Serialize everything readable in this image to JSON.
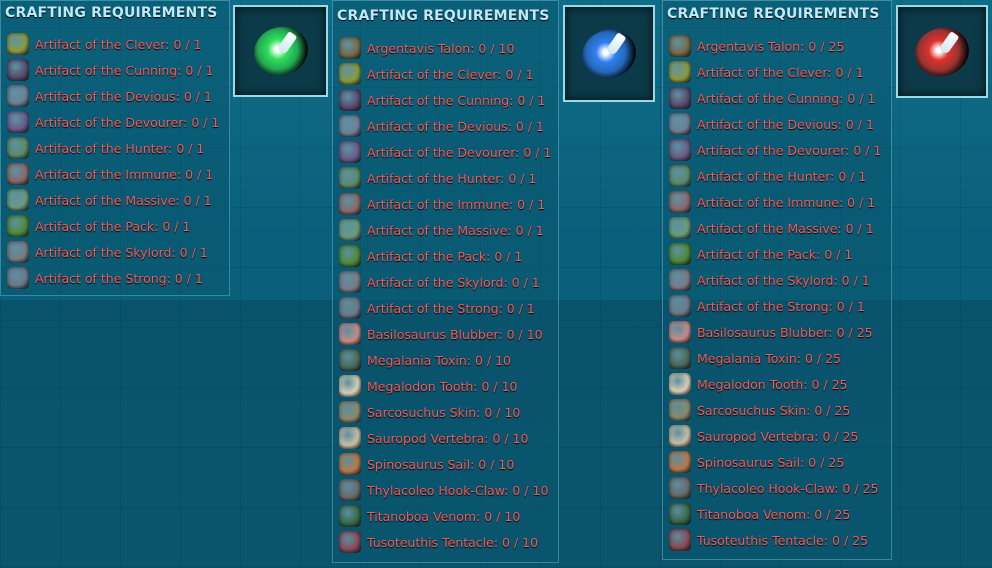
{
  "panels": [
    {
      "title": "CRAFTING REQUIREMENTS",
      "item_icon": "green-tribute-orb-icon",
      "orb_color": "#2fe05a",
      "items": [
        {
          "label": "Artifact of the Clever: 0 / 1",
          "icon": "artifact-clever-icon",
          "color": "#8c9a3e"
        },
        {
          "label": "Artifact of the Cunning: 0 / 1",
          "icon": "artifact-cunning-icon",
          "color": "#5a4a6e"
        },
        {
          "label": "Artifact of the Devious: 0 / 1",
          "icon": "artifact-devious-icon",
          "color": "#6f7f95"
        },
        {
          "label": "Artifact of the Devourer: 0 / 1",
          "icon": "artifact-devourer-icon",
          "color": "#6a5a8a"
        },
        {
          "label": "Artifact of the Hunter: 0 / 1",
          "icon": "artifact-hunter-icon",
          "color": "#5a8a6a"
        },
        {
          "label": "Artifact of the Immune: 0 / 1",
          "icon": "artifact-immune-icon",
          "color": "#8a6a6a"
        },
        {
          "label": "Artifact of the Massive: 0 / 1",
          "icon": "artifact-massive-icon",
          "color": "#6a9a7a"
        },
        {
          "label": "Artifact of the Pack: 0 / 1",
          "icon": "artifact-pack-icon",
          "color": "#4f8a3a"
        },
        {
          "label": "Artifact of the Skylord: 0 / 1",
          "icon": "artifact-skylord-icon",
          "color": "#7a7a86"
        },
        {
          "label": "Artifact of the Strong: 0 / 1",
          "icon": "artifact-strong-icon",
          "color": "#6a7a8a"
        }
      ]
    },
    {
      "title": "CRAFTING REQUIREMENTS",
      "item_icon": "blue-tribute-orb-icon",
      "orb_color": "#2f7ff0",
      "items": [
        {
          "label": "Argentavis Talon: 0 / 10",
          "icon": "argentavis-talon-icon",
          "color": "#7a6a4a"
        },
        {
          "label": "Artifact of the Clever: 0 / 1",
          "icon": "artifact-clever-icon",
          "color": "#8c9a3e"
        },
        {
          "label": "Artifact of the Cunning: 0 / 1",
          "icon": "artifact-cunning-icon",
          "color": "#5a4a6e"
        },
        {
          "label": "Artifact of the Devious: 0 / 1",
          "icon": "artifact-devious-icon",
          "color": "#6f7f95"
        },
        {
          "label": "Artifact of the Devourer: 0 / 1",
          "icon": "artifact-devourer-icon",
          "color": "#6a5a8a"
        },
        {
          "label": "Artifact of the Hunter: 0 / 1",
          "icon": "artifact-hunter-icon",
          "color": "#5a8a6a"
        },
        {
          "label": "Artifact of the Immune: 0 / 1",
          "icon": "artifact-immune-icon",
          "color": "#8a6a6a"
        },
        {
          "label": "Artifact of the Massive: 0 / 1",
          "icon": "artifact-massive-icon",
          "color": "#6a9a7a"
        },
        {
          "label": "Artifact of the Pack: 0 / 1",
          "icon": "artifact-pack-icon",
          "color": "#4f8a3a"
        },
        {
          "label": "Artifact of the Skylord: 0 / 1",
          "icon": "artifact-skylord-icon",
          "color": "#7a7a86"
        },
        {
          "label": "Artifact of the Strong: 0 / 1",
          "icon": "artifact-strong-icon",
          "color": "#6a7a8a"
        },
        {
          "label": "Basilosaurus Blubber: 0 / 10",
          "icon": "basilosaurus-blubber-icon",
          "color": "#c88a8a"
        },
        {
          "label": "Megalania Toxin: 0 / 10",
          "icon": "megalania-toxin-icon",
          "color": "#4a6a5a"
        },
        {
          "label": "Megalodon Tooth: 0 / 10",
          "icon": "megalodon-tooth-icon",
          "color": "#d8d0b8"
        },
        {
          "label": "Sarcosuchus Skin: 0 / 10",
          "icon": "sarcosuchus-skin-icon",
          "color": "#8a8a6a"
        },
        {
          "label": "Sauropod Vertebra: 0 / 10",
          "icon": "sauropod-vertebra-icon",
          "color": "#c8c0a8"
        },
        {
          "label": "Spinosaurus Sail: 0 / 10",
          "icon": "spinosaurus-sail-icon",
          "color": "#b87a4a"
        },
        {
          "label": "Thylacoleo Hook-Claw: 0 / 10",
          "icon": "thylacoleo-hook-claw-icon",
          "color": "#6a6a6a"
        },
        {
          "label": "Titanoboa Venom: 0 / 10",
          "icon": "titanoboa-venom-icon",
          "color": "#3a6a4a"
        },
        {
          "label": "Tusoteuthis Tentacle: 0 / 10",
          "icon": "tusoteuthis-tentacle-icon",
          "color": "#8a4a5a"
        }
      ]
    },
    {
      "title": "CRAFTING REQUIREMENTS",
      "item_icon": "red-tribute-orb-icon",
      "orb_color": "#e0302a",
      "items": [
        {
          "label": "Argentavis Talon: 0 / 25",
          "icon": "argentavis-talon-icon",
          "color": "#7a6a4a"
        },
        {
          "label": "Artifact of the Clever: 0 / 1",
          "icon": "artifact-clever-icon",
          "color": "#8c9a3e"
        },
        {
          "label": "Artifact of the Cunning: 0 / 1",
          "icon": "artifact-cunning-icon",
          "color": "#5a4a6e"
        },
        {
          "label": "Artifact of the Devious: 0 / 1",
          "icon": "artifact-devious-icon",
          "color": "#6f7f95"
        },
        {
          "label": "Artifact of the Devourer: 0 / 1",
          "icon": "artifact-devourer-icon",
          "color": "#6a5a8a"
        },
        {
          "label": "Artifact of the Hunter: 0 / 1",
          "icon": "artifact-hunter-icon",
          "color": "#5a8a6a"
        },
        {
          "label": "Artifact of the Immune: 0 / 1",
          "icon": "artifact-immune-icon",
          "color": "#8a6a6a"
        },
        {
          "label": "Artifact of the Massive: 0 / 1",
          "icon": "artifact-massive-icon",
          "color": "#6a9a7a"
        },
        {
          "label": "Artifact of the Pack: 0 / 1",
          "icon": "artifact-pack-icon",
          "color": "#4f8a3a"
        },
        {
          "label": "Artifact of the Skylord: 0 / 1",
          "icon": "artifact-skylord-icon",
          "color": "#7a7a86"
        },
        {
          "label": "Artifact of the Strong: 0 / 1",
          "icon": "artifact-strong-icon",
          "color": "#6a7a8a"
        },
        {
          "label": "Basilosaurus Blubber: 0 / 25",
          "icon": "basilosaurus-blubber-icon",
          "color": "#c88a8a"
        },
        {
          "label": "Megalania Toxin: 0 / 25",
          "icon": "megalania-toxin-icon",
          "color": "#4a6a5a"
        },
        {
          "label": "Megalodon Tooth: 0 / 25",
          "icon": "megalodon-tooth-icon",
          "color": "#d8d0b8"
        },
        {
          "label": "Sarcosuchus Skin: 0 / 25",
          "icon": "sarcosuchus-skin-icon",
          "color": "#8a8a6a"
        },
        {
          "label": "Sauropod Vertebra: 0 / 25",
          "icon": "sauropod-vertebra-icon",
          "color": "#c8c0a8"
        },
        {
          "label": "Spinosaurus Sail: 0 / 25",
          "icon": "spinosaurus-sail-icon",
          "color": "#b87a4a"
        },
        {
          "label": "Thylacoleo Hook-Claw: 0 / 25",
          "icon": "thylacoleo-hook-claw-icon",
          "color": "#6a6a6a"
        },
        {
          "label": "Titanoboa Venom: 0 / 25",
          "icon": "titanoboa-venom-icon",
          "color": "#3a6a4a"
        },
        {
          "label": "Tusoteuthis Tentacle: 0 / 25",
          "icon": "tusoteuthis-tentacle-icon",
          "color": "#8a4a5a"
        }
      ]
    }
  ]
}
